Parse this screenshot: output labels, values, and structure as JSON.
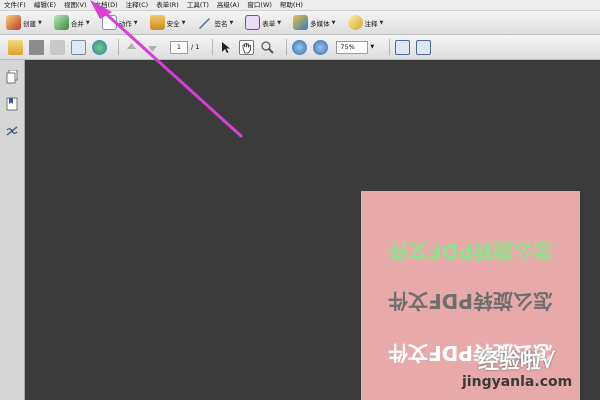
{
  "menubar": {
    "items": [
      "文件(F)",
      "编辑(E)",
      "视图(V)",
      "文档(D)",
      "注释(C)",
      "表单(R)",
      "工具(T)",
      "高级(A)",
      "窗口(W)",
      "帮助(H)"
    ]
  },
  "tasks_toolbar": {
    "items": [
      {
        "label": "创建",
        "icon": "create-pdf-icon",
        "color": "#c0392b"
      },
      {
        "label": "合并",
        "icon": "combine-files-icon",
        "color": "#3b8a3b"
      },
      {
        "label": "动作",
        "icon": "action-wizard-icon",
        "color": "#5a5a9a"
      },
      {
        "label": "安全",
        "icon": "lock-icon",
        "color": "#c98a1e"
      },
      {
        "label": "签名",
        "icon": "pen-sign-icon",
        "color": "#4a6aa0"
      },
      {
        "label": "表单",
        "icon": "form-icon",
        "color": "#7a4aa0"
      },
      {
        "label": "多媒体",
        "icon": "multimedia-icon",
        "color": "#2a7ac0"
      },
      {
        "label": "注释",
        "icon": "comment-icon",
        "color": "#d8a52a"
      }
    ]
  },
  "nav_toolbar": {
    "page_current": "1",
    "page_total": "/ 1",
    "zoom": "75%"
  },
  "document": {
    "lines": [
      "怎么旋转PDF文件",
      "怎么旋转PDF文件",
      "怎么旋转PDF文件"
    ],
    "colors": {
      "page": "#e8a9a9",
      "line1": "#8fe08f",
      "line2": "#6e6e6e",
      "line3": "#ffffff"
    }
  },
  "watermark": {
    "main_text": "经验啦",
    "check_mark": "√",
    "url": "jingyanla.com"
  },
  "annotation": {
    "arrow_color": "#d640d6"
  }
}
